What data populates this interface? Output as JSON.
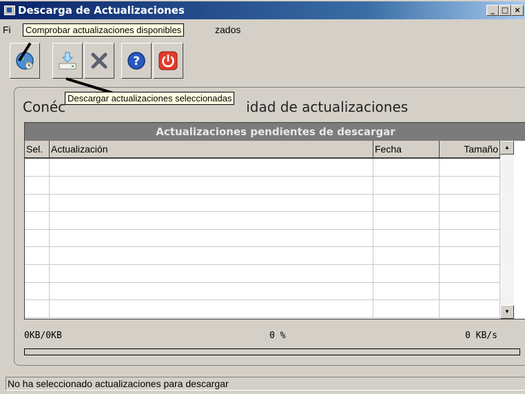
{
  "window": {
    "title": "Descarga de Actualizaciones"
  },
  "menu": {
    "left_fragment": "Fi",
    "right_fragment": "zados"
  },
  "tooltips": {
    "check": "Comprobar actualizaciones disponibles",
    "download": "Descargar actualizaciones seleccionadas"
  },
  "toolbar": {
    "buttons": [
      {
        "icon": "globe-icon"
      },
      {
        "icon": "download-icon"
      },
      {
        "icon": "cancel-x-icon"
      },
      {
        "icon": "help-icon"
      },
      {
        "icon": "power-icon"
      }
    ]
  },
  "heading": {
    "start": "Conéc",
    "end": "idad de actualizaciones"
  },
  "grid": {
    "title": "Actualizaciones pendientes de descargar",
    "columns": [
      "Sel.",
      "Actualización",
      "Fecha",
      "Tamaño"
    ],
    "rows": [
      [],
      [],
      [],
      [],
      [],
      [],
      [],
      [],
      []
    ]
  },
  "stats": {
    "downloaded": "0KB/0KB",
    "percent": "0 %",
    "speed": "0 KB/s"
  },
  "progress": {
    "value": 0
  },
  "status": "No ha seleccionado actualizaciones para descargar",
  "colors": {
    "title_start": "#0a246a",
    "grid_header": "#7b7b7b",
    "tooltip_bg": "#ffffe1"
  }
}
